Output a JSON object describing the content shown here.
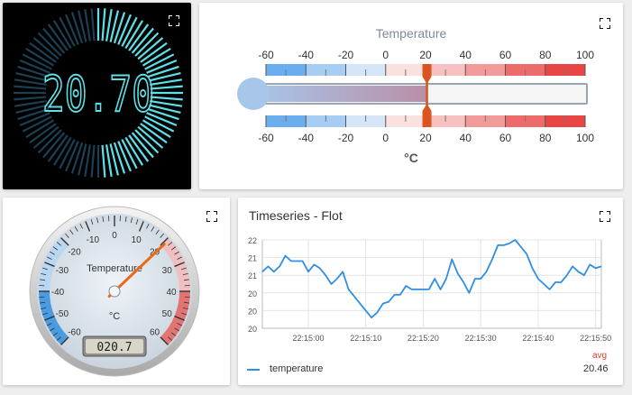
{
  "digital_gauge": {
    "value_text": "20.70",
    "value": 20.7,
    "min": -60,
    "max": 100,
    "colors": {
      "active": "#5fe0e8",
      "inactive": "#1c3f52",
      "bg": "#000000"
    }
  },
  "thermometer": {
    "title": "Temperature",
    "unit": "°C",
    "ticks": [
      "-60",
      "-40",
      "-20",
      "0",
      "20",
      "40",
      "60",
      "80",
      "100"
    ],
    "value": 20.7,
    "min": -60,
    "max": 100,
    "colors": {
      "cold": "#5aa6e8",
      "hot": "#e84a4a",
      "pointer": "#d9541e"
    }
  },
  "analog_gauge": {
    "label": "Temperature",
    "unit": "°C",
    "ticks": [
      "-60",
      "-50",
      "-40",
      "-30",
      "-20",
      "-10",
      "0",
      "10",
      "20",
      "30",
      "40",
      "50",
      "60"
    ],
    "value": 20.7,
    "min": -60,
    "max": 60,
    "lcd_text": "020.7",
    "colors": {
      "needle": "#e86a1a",
      "cold": "#4a9be0",
      "hot": "#e06a6a"
    }
  },
  "timeseries": {
    "title": "Timeseries - Flot",
    "legend_header": "avg",
    "legend": [
      {
        "label": "temperature",
        "avg": "20.46",
        "color": "#2f8fe0"
      }
    ]
  },
  "chart_data": {
    "type": "line",
    "title": "Timeseries - Flot",
    "xlabel": "",
    "ylabel": "",
    "x_ticks": [
      "22:15:00",
      "22:15:10",
      "22:15:20",
      "22:15:30",
      "22:15:40",
      "22:15:50"
    ],
    "y_ticks": [
      "20",
      "20",
      "21",
      "21",
      "22"
    ],
    "ylim": [
      19.5,
      22
    ],
    "x": [
      "22:14:52",
      "22:14:53",
      "22:14:54",
      "22:14:55",
      "22:14:56",
      "22:14:57",
      "22:14:58",
      "22:14:59",
      "22:15:00",
      "22:15:01",
      "22:15:02",
      "22:15:03",
      "22:15:04",
      "22:15:05",
      "22:15:06",
      "22:15:07",
      "22:15:08",
      "22:15:09",
      "22:15:10",
      "22:15:11",
      "22:15:12",
      "22:15:13",
      "22:15:14",
      "22:15:15",
      "22:15:16",
      "22:15:17",
      "22:15:18",
      "22:15:19",
      "22:15:20",
      "22:15:21",
      "22:15:22",
      "22:15:23",
      "22:15:24",
      "22:15:25",
      "22:15:26",
      "22:15:27",
      "22:15:28",
      "22:15:29",
      "22:15:30",
      "22:15:31",
      "22:15:32",
      "22:15:33",
      "22:15:34",
      "22:15:35",
      "22:15:36",
      "22:15:37",
      "22:15:38",
      "22:15:39",
      "22:15:40",
      "22:15:41",
      "22:15:42",
      "22:15:43",
      "22:15:44",
      "22:15:45",
      "22:15:46",
      "22:15:47",
      "22:15:48",
      "22:15:49",
      "22:15:50",
      "22:15:51"
    ],
    "series": [
      {
        "name": "temperature",
        "values": [
          21.1,
          21.25,
          21.1,
          21.25,
          21.55,
          21.4,
          21.4,
          21.4,
          21.1,
          21.3,
          21.2,
          21.0,
          20.75,
          20.9,
          21.1,
          20.6,
          20.4,
          20.2,
          20.0,
          19.8,
          19.95,
          20.2,
          20.25,
          20.45,
          20.45,
          20.7,
          20.6,
          20.6,
          20.6,
          20.6,
          20.9,
          20.6,
          20.9,
          21.45,
          21.05,
          20.8,
          20.5,
          20.9,
          20.9,
          21.1,
          21.45,
          21.85,
          21.85,
          21.9,
          22.0,
          21.8,
          21.6,
          21.2,
          20.9,
          20.75,
          20.6,
          20.8,
          20.8,
          21.0,
          21.25,
          21.1,
          21.0,
          21.3,
          21.2,
          21.25
        ],
        "color": "#2f8fe0"
      }
    ],
    "legend": {
      "placement": "bottom-left",
      "header": "avg"
    },
    "grid": true
  }
}
